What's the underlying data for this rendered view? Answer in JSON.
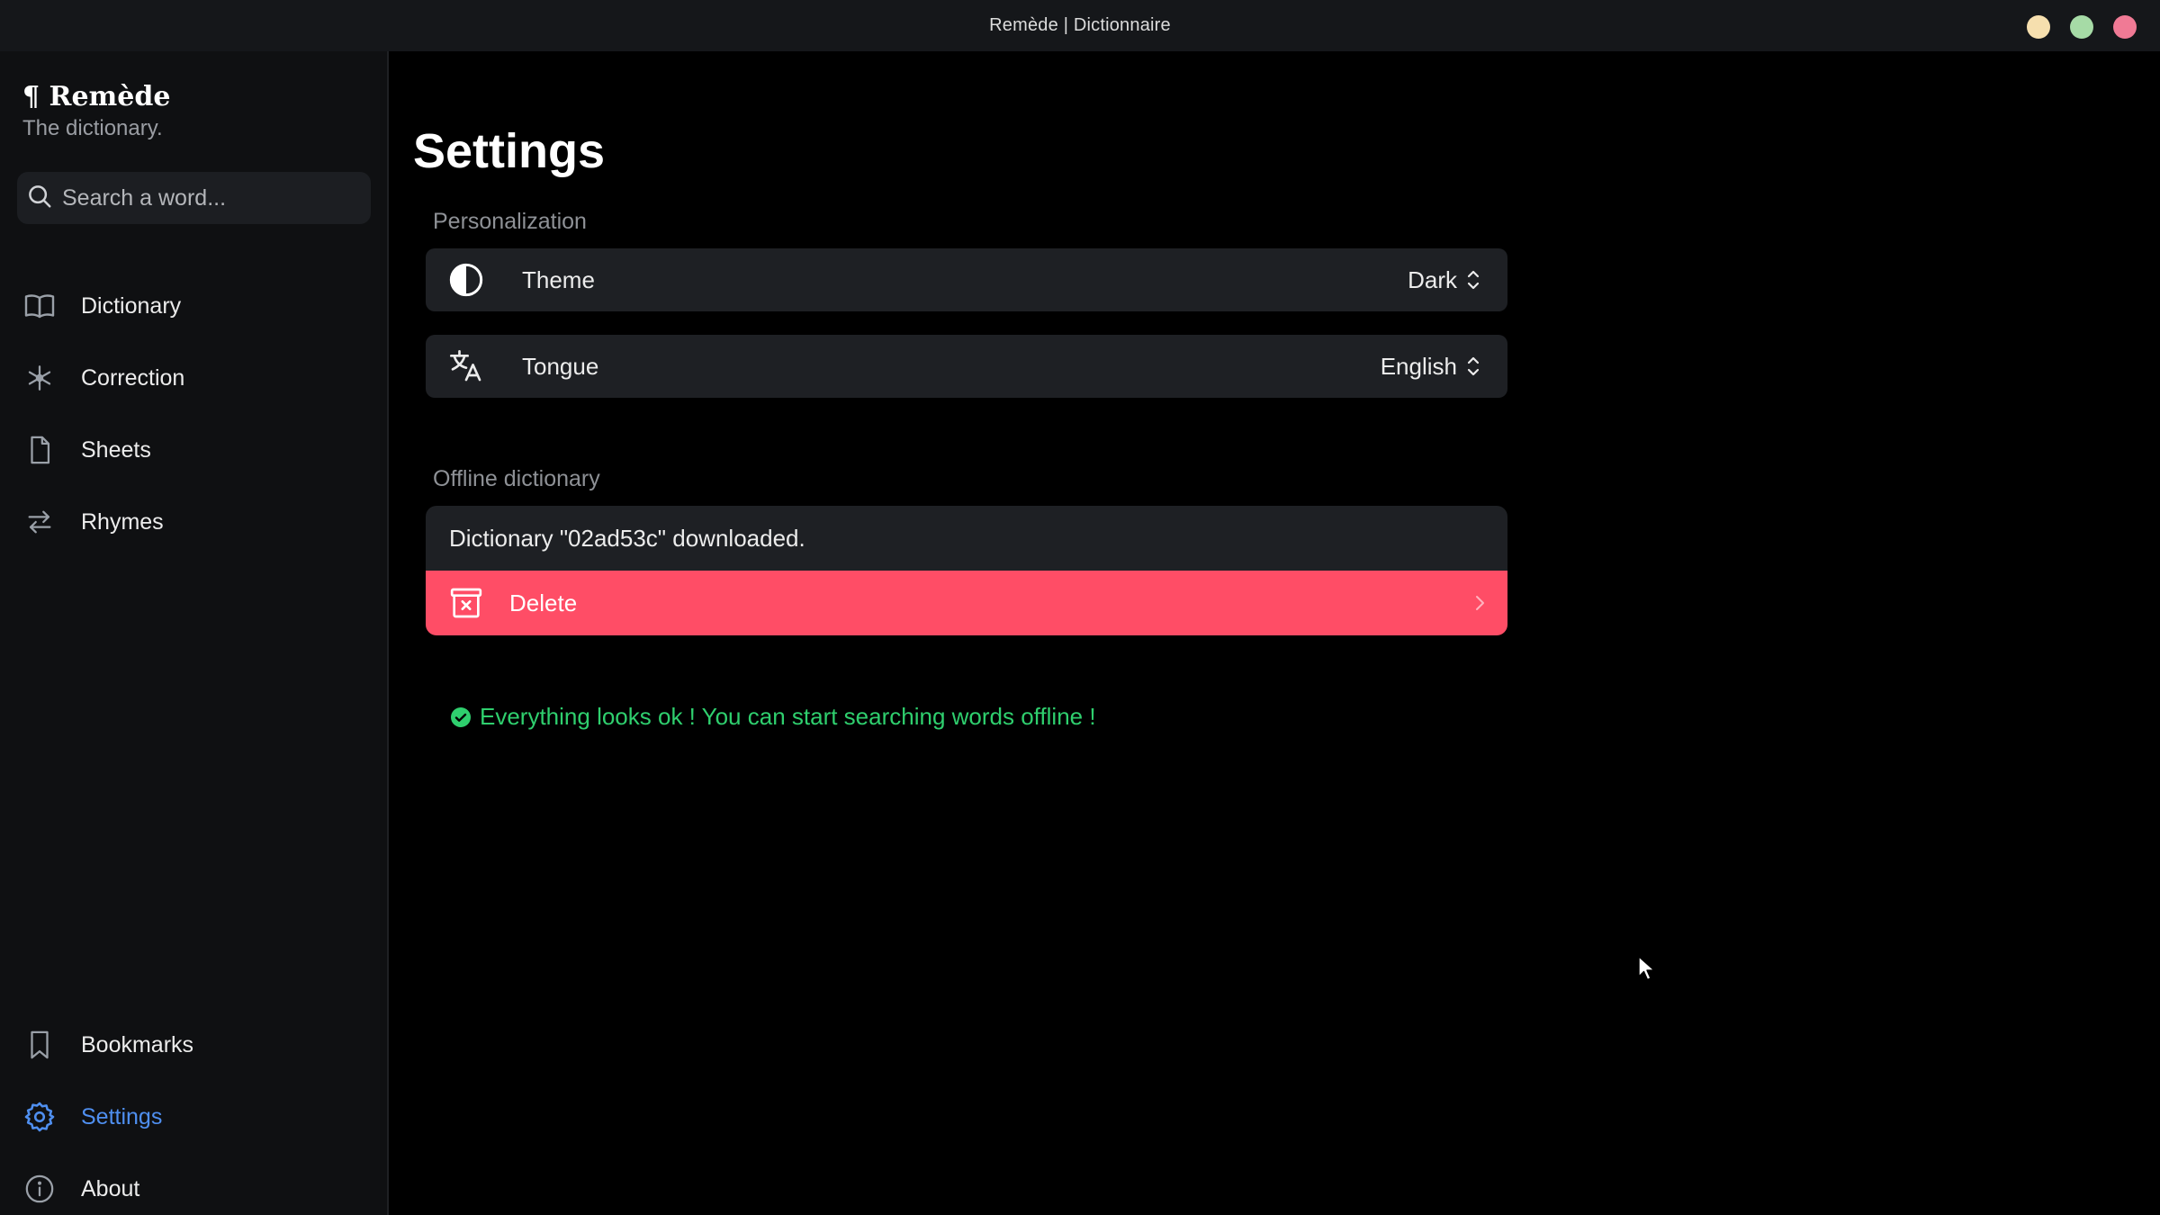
{
  "window": {
    "title": "Remède | Dictionnaire"
  },
  "sidebar": {
    "brand": {
      "name": "¶ Remède",
      "tagline": "The dictionary."
    },
    "search": {
      "placeholder": "Search a word..."
    },
    "items": [
      {
        "label": "Dictionary",
        "icon": "book-open-icon"
      },
      {
        "label": "Correction",
        "icon": "asterisk-icon"
      },
      {
        "label": "Sheets",
        "icon": "file-icon"
      },
      {
        "label": "Rhymes",
        "icon": "arrows-swap-icon"
      }
    ],
    "bottom_items": [
      {
        "label": "Bookmarks",
        "icon": "bookmark-icon"
      },
      {
        "label": "Settings",
        "icon": "gear-icon",
        "active": true
      },
      {
        "label": "About",
        "icon": "info-icon"
      }
    ]
  },
  "main": {
    "title": "Settings",
    "personalization": {
      "label": "Personalization",
      "theme": {
        "label": "Theme",
        "value": "Dark",
        "icon": "contrast-icon"
      },
      "tongue": {
        "label": "Tongue",
        "value": "English",
        "icon": "translate-icon"
      }
    },
    "offline": {
      "label": "Offline dictionary",
      "status": "Dictionary \"02ad53c\" downloaded.",
      "delete_label": "Delete",
      "ok_message": "Everything looks ok ! You can start searching words offline !"
    }
  },
  "colors": {
    "accent": "#4f8ff0",
    "danger": "#ff4d66",
    "success": "#2fcf6e",
    "card": "#1e2024",
    "sidebar": "#0f1012"
  }
}
